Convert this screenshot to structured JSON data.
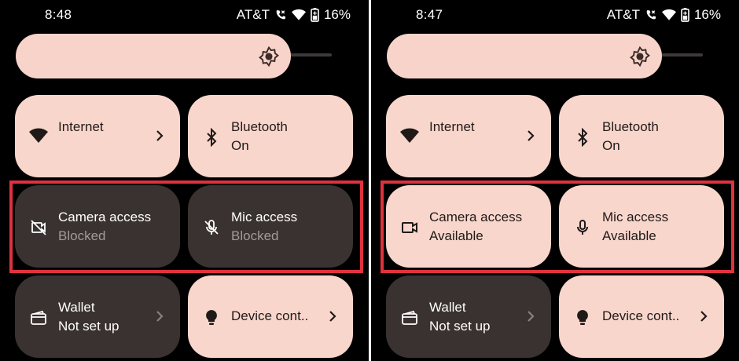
{
  "left": {
    "status": {
      "time": "8:48",
      "carrier": "AT&T",
      "battery": "16%"
    },
    "tiles": {
      "internet": {
        "title": "Internet"
      },
      "bluetooth": {
        "title": "Bluetooth",
        "subtitle": "On"
      },
      "camera": {
        "title": "Camera access",
        "subtitle": "Blocked"
      },
      "mic": {
        "title": "Mic access",
        "subtitle": "Blocked"
      },
      "wallet": {
        "title": "Wallet",
        "subtitle": "Not set up"
      },
      "device": {
        "title": "Device cont.."
      }
    }
  },
  "right": {
    "status": {
      "time": "8:47",
      "carrier": "AT&T",
      "battery": "16%"
    },
    "tiles": {
      "internet": {
        "title": "Internet"
      },
      "bluetooth": {
        "title": "Bluetooth",
        "subtitle": "On"
      },
      "camera": {
        "title": "Camera access",
        "subtitle": "Available"
      },
      "mic": {
        "title": "Mic access",
        "subtitle": "Available"
      },
      "wallet": {
        "title": "Wallet",
        "subtitle": "Not set up"
      },
      "device": {
        "title": "Device cont.."
      }
    }
  },
  "colors": {
    "tile_active": "#f9d6cc",
    "tile_inactive": "#3a3230",
    "highlight_border": "#e0323e",
    "background": "#000000"
  },
  "icons": [
    "wifi-icon",
    "bluetooth-icon",
    "camera-off-icon",
    "mic-off-icon",
    "camera-icon",
    "mic-icon",
    "wallet-icon",
    "lightbulb-icon",
    "chevron-right-icon",
    "brightness-icon",
    "wifi-calling-icon",
    "wifi-status-icon",
    "battery-saver-icon"
  ]
}
